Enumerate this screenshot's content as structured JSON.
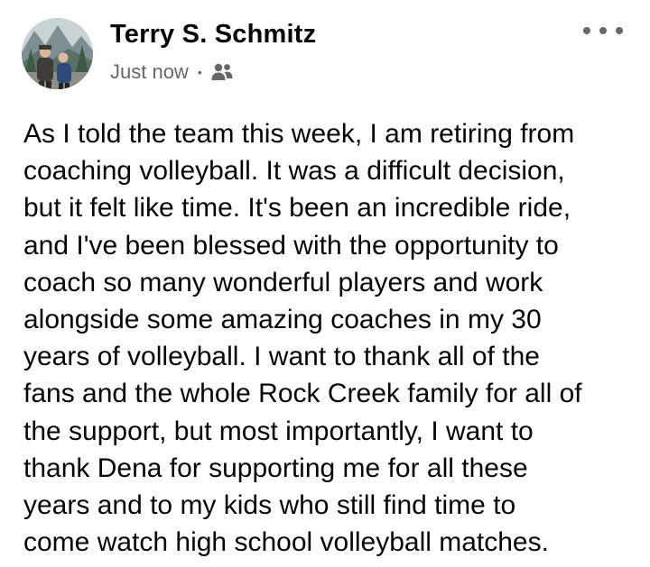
{
  "post": {
    "author_name": "Terry S. Schmitz",
    "timestamp": "Just now",
    "separator": "•",
    "audience_icon": "friends-icon",
    "more_icon": "more-options-icon",
    "body_lines": [
      "As I told the team this week, I am retiring from",
      "coaching volleyball. It was a difficult decision,",
      "but it felt like time. It's been an incredible ride,",
      "and I've been blessed with the opportunity to",
      "coach so many wonderful players and work",
      "alongside some amazing coaches in my 30",
      "years of volleyball. I want to thank all of the",
      "fans and the whole Rock Creek family for all of",
      "the support, but most importantly, I want to",
      "thank Dena for supporting me for all these",
      "years and to my kids who still find time to",
      "come watch high school volleyball matches."
    ]
  },
  "colors": {
    "text_primary": "#050505",
    "text_secondary": "#65676b",
    "background": "#ffffff"
  }
}
